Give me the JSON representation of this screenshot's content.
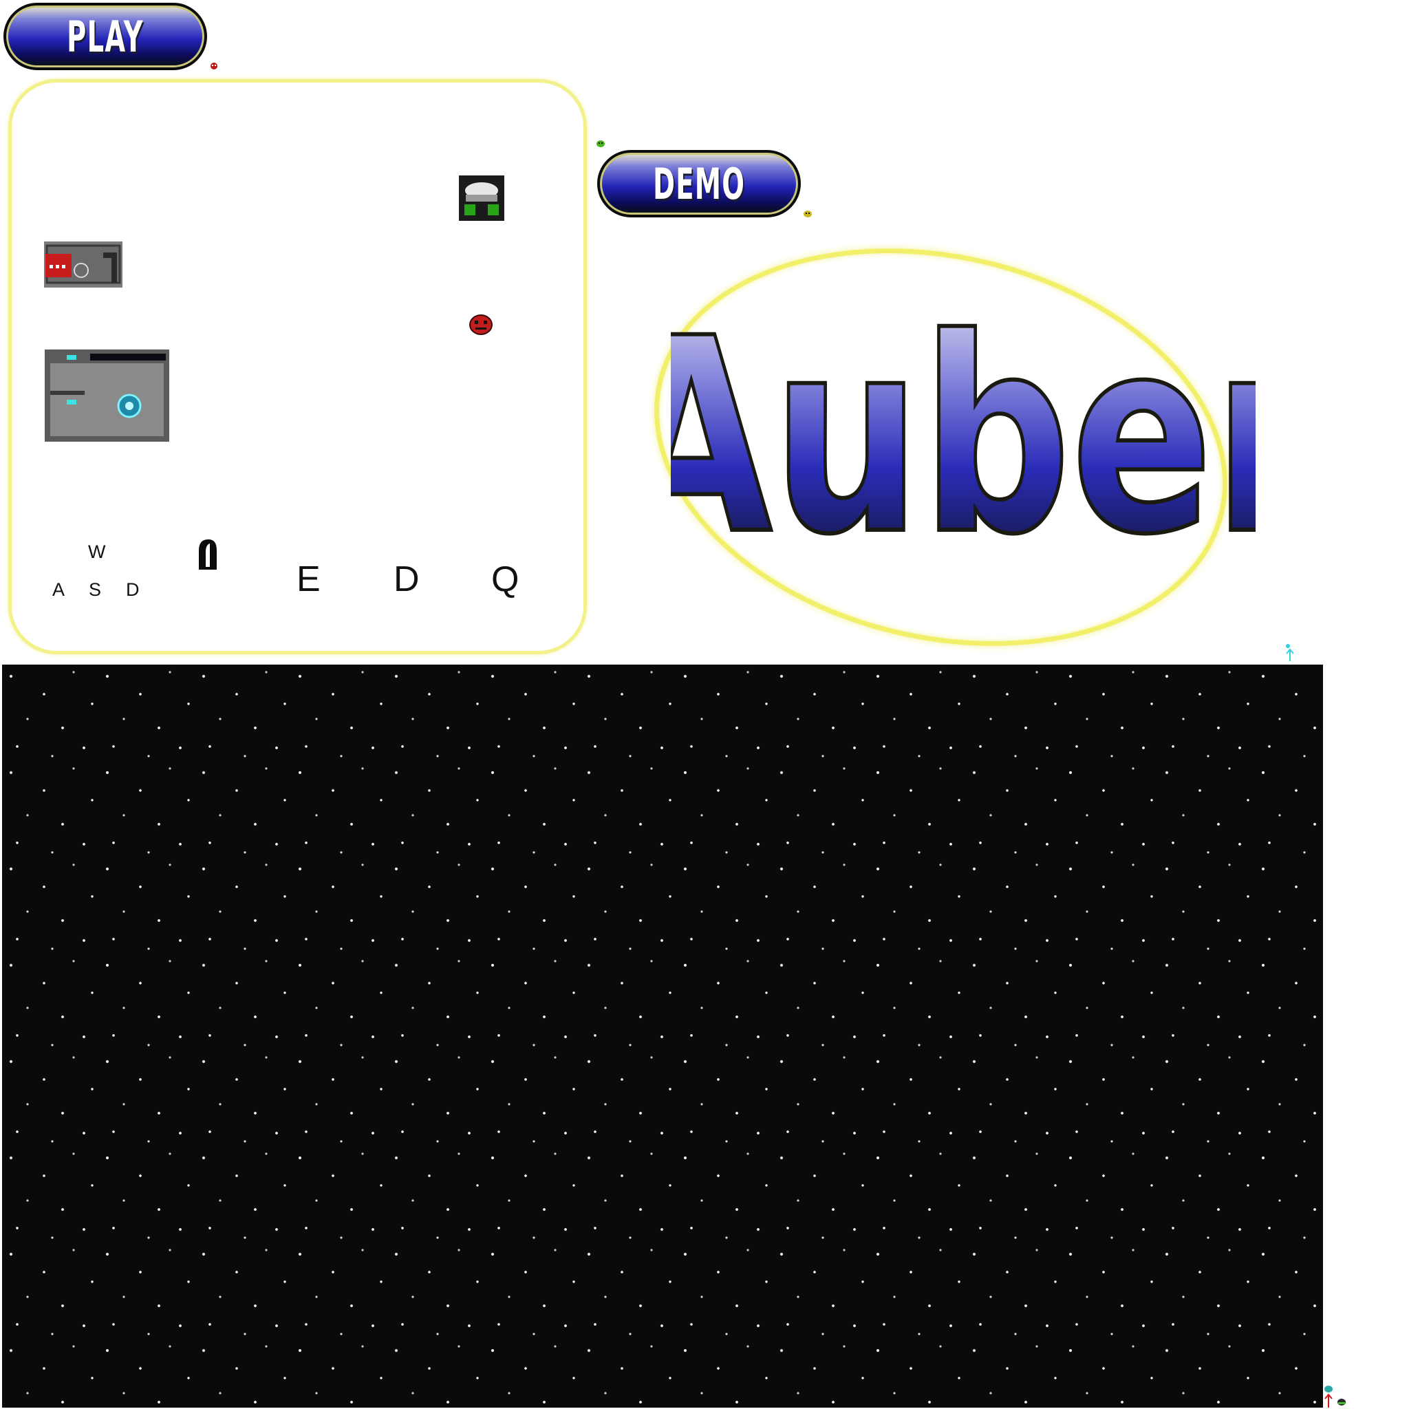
{
  "buttons": {
    "play_label": "PLAY",
    "demo_label": "DEMO"
  },
  "controls": {
    "movement_keys": {
      "up": "W",
      "left": "A",
      "down": "S",
      "right": "D"
    },
    "action_keys": [
      "E",
      "D",
      "Q"
    ]
  },
  "logo": {
    "text": "Auber"
  },
  "icons": {
    "mouse": "mouse-click-icon",
    "ship": "spaceship-icon",
    "enemy": "red-alien-icon",
    "player": "red-player-sprite-icon",
    "room": "station-room-icon",
    "teleporter": "teleporter-pad-icon"
  },
  "colors": {
    "panel_border": "#f3f18a",
    "button_blue": "#2224b7",
    "logo_ring": "#f2f06a",
    "space_bg": "#0a0a0a"
  }
}
